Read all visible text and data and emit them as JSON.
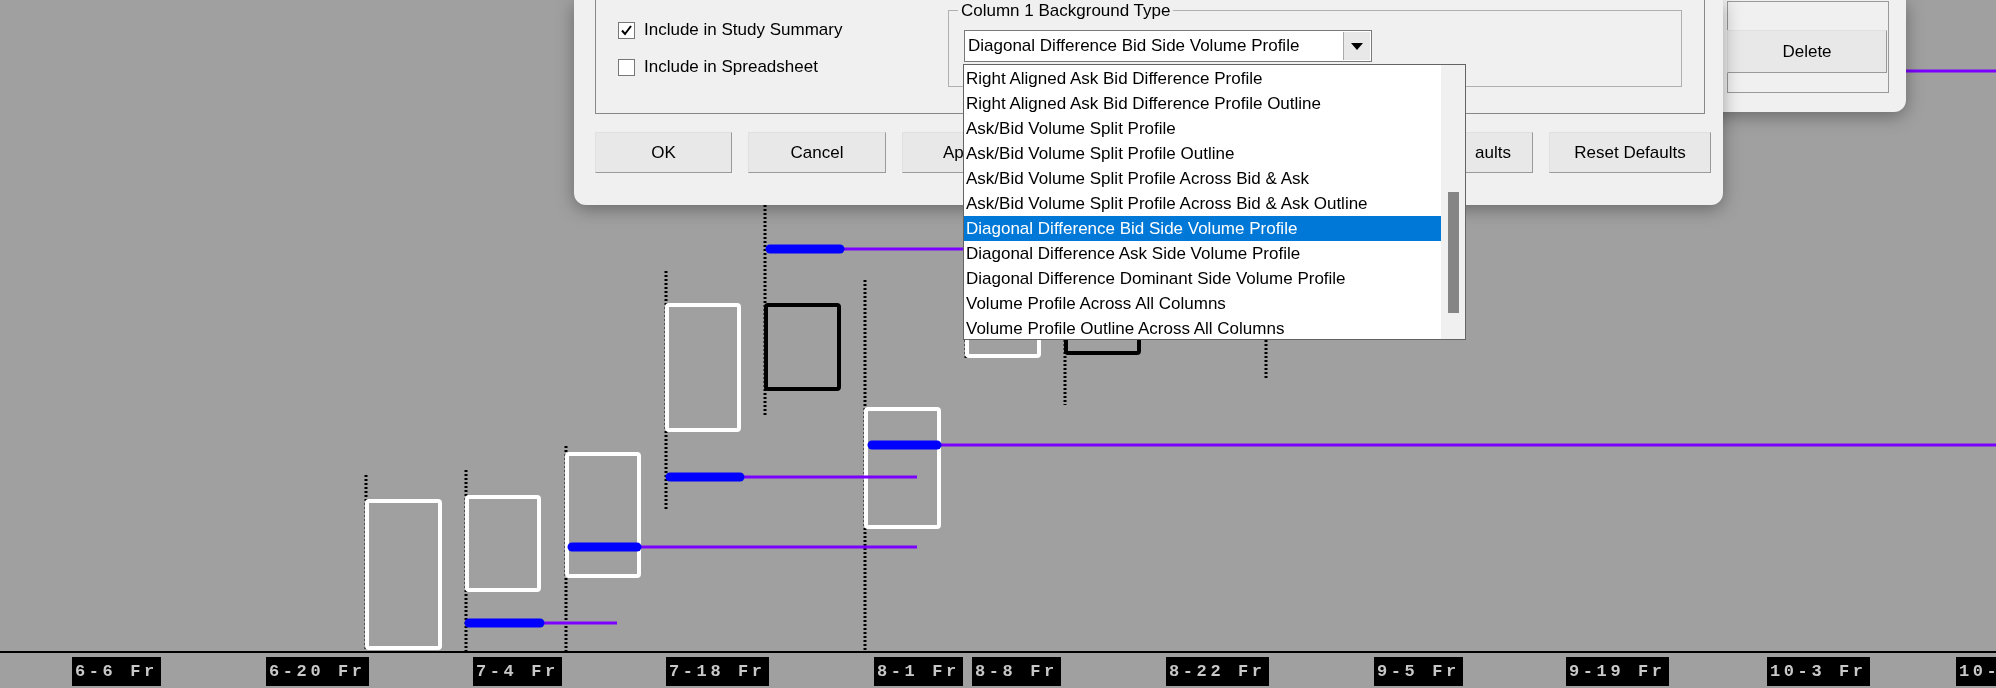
{
  "study_settings_dialog": {
    "checkboxes": [
      {
        "label": "Include in Study Summary",
        "checked": true
      },
      {
        "label": "Include in Spreadsheet",
        "checked": false
      }
    ],
    "background_type": {
      "label": "Column 1 Background Type",
      "value": "Diagonal Difference Bid Side Volume Profile",
      "options": [
        {
          "label": "Right Aligned Ask Bid Difference Profile",
          "selected": false
        },
        {
          "label": "Right Aligned Ask Bid Difference Profile Outline",
          "selected": false
        },
        {
          "label": "Ask/Bid Volume Split Profile",
          "selected": false
        },
        {
          "label": "Ask/Bid Volume Split Profile Outline",
          "selected": false
        },
        {
          "label": "Ask/Bid Volume Split Profile Across Bid & Ask",
          "selected": false
        },
        {
          "label": "Ask/Bid Volume Split Profile Across Bid & Ask Outline",
          "selected": false
        },
        {
          "label": "Diagonal Difference Bid Side Volume Profile",
          "selected": true
        },
        {
          "label": "Diagonal Difference Ask Side Volume Profile",
          "selected": false
        },
        {
          "label": "Diagonal Difference Dominant Side Volume Profile",
          "selected": false
        },
        {
          "label": "Volume Profile Across All Columns",
          "selected": false
        },
        {
          "label": "Volume Profile Outline Across All Columns",
          "selected": false
        }
      ]
    },
    "buttons": [
      "OK",
      "Cancel",
      "Ap",
      "aults",
      "Reset Defaults"
    ]
  },
  "second_dialog": {
    "buttons": [
      "Delete"
    ]
  },
  "chart": {
    "x_axis_labels": [
      "6-6 Fr",
      "6-20 Fr",
      "7-4 Fr",
      "7-18 Fr",
      "8-1 Fr",
      "8-8 Fr",
      "8-22 Fr",
      "9-5 Fr",
      "9-19 Fr",
      "10-3 Fr",
      "10-"
    ]
  }
}
